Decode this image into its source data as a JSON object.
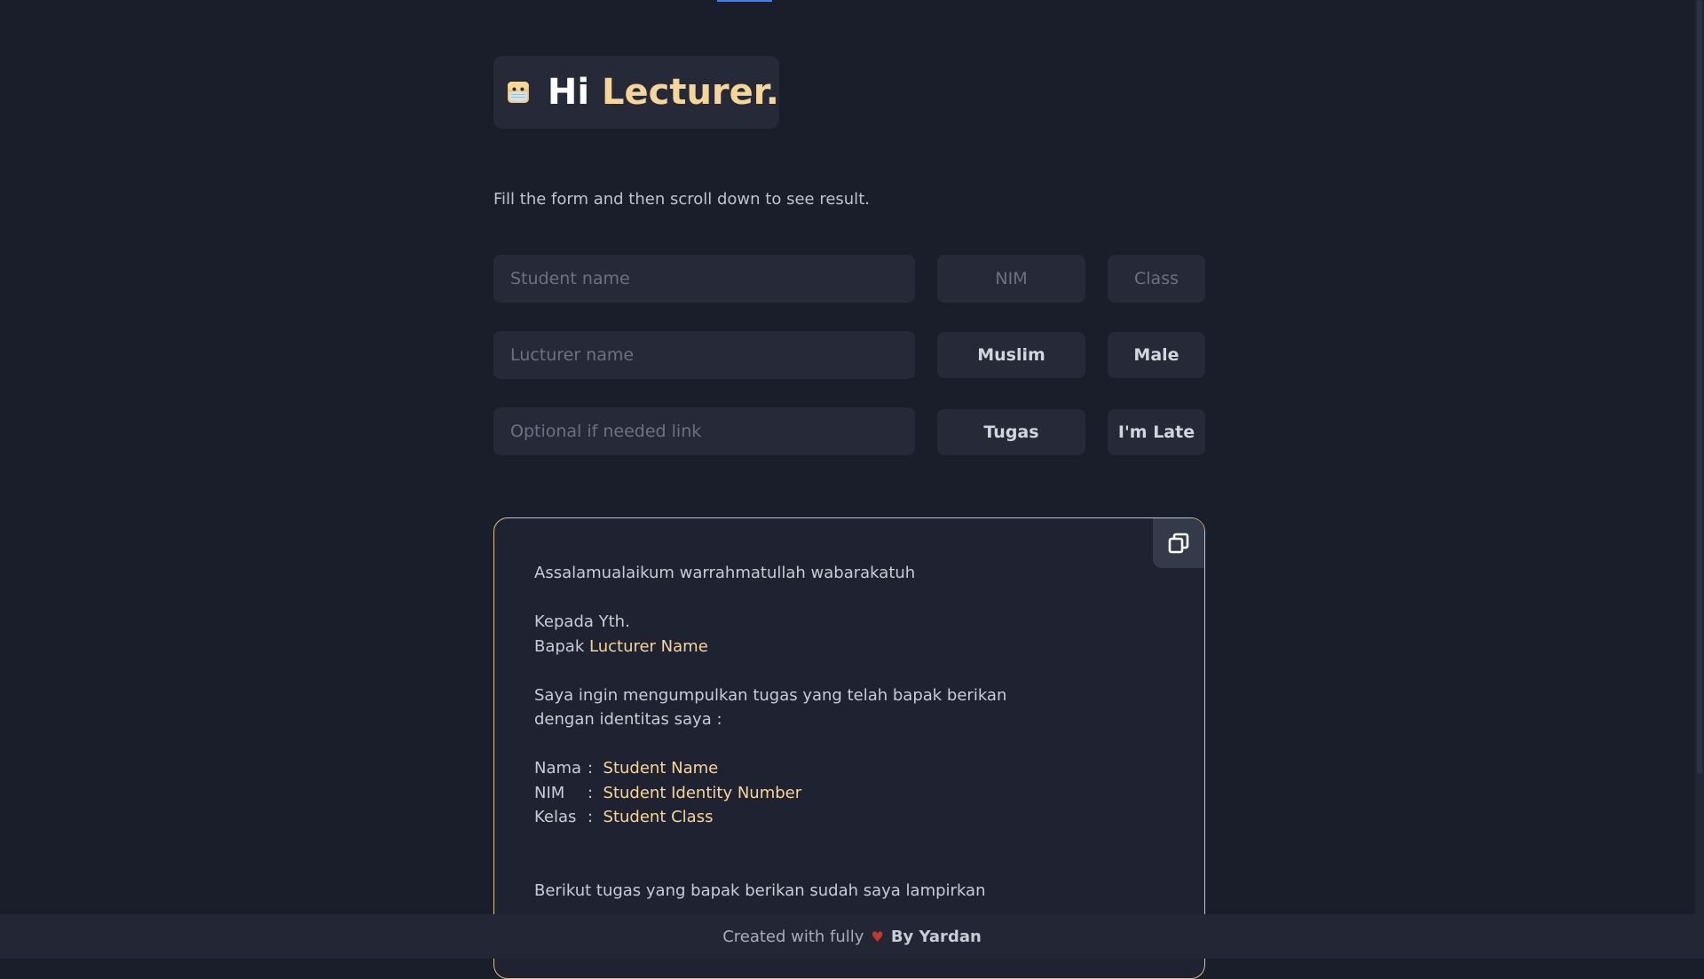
{
  "header": {
    "greeting": "Hi",
    "name": "Lecturer."
  },
  "intro": "Fill the form and then scroll down to see result.",
  "form": {
    "student_name_placeholder": "Student name",
    "nim_placeholder": "NIM",
    "class_placeholder": "Class",
    "lecturer_name_placeholder": "Lucturer name",
    "religion_button": "Muslim",
    "gender_button": "Male",
    "link_placeholder": "Optional if needed link",
    "type_button": "Tugas",
    "late_button": "I'm Late"
  },
  "result": {
    "salam": "Assalamualaikum warrahmatullah wabarakatuh",
    "kepada": "Kepada Yth.",
    "bapak_prefix": "Bapak",
    "lecturer_name": "Lucturer Name",
    "body_line1": "Saya ingin mengumpulkan tugas yang telah bapak berikan",
    "body_line2": "dengan identitas saya :",
    "nama_label": "Nama",
    "nim_label": "NIM",
    "kelas_label": "Kelas",
    "separator": ":",
    "student_name": "Student Name",
    "student_nim": "Student Identity Number",
    "student_class": "Student Class",
    "closing_line1": "Berikut tugas yang bapak berikan sudah saya lampirkan"
  },
  "footer": {
    "prefix": "Created with fully",
    "heart": "♥",
    "author": "By Yardan"
  },
  "colors": {
    "background": "#1a1d2a",
    "card": "#262a38",
    "accent": "#f6d59a",
    "border": "#d9c08d"
  }
}
